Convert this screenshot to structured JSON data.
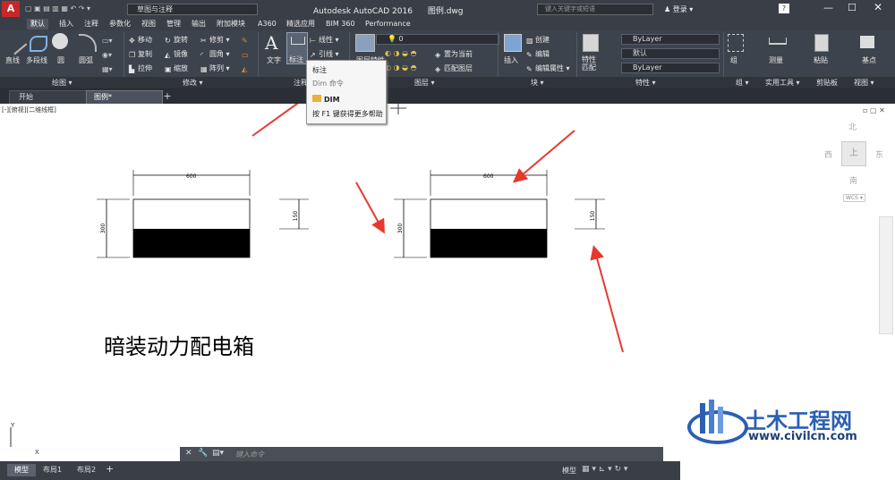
{
  "app": {
    "title": "Autodesk AutoCAD 2016",
    "file": "图例.dwg",
    "workspace": "草图与注释",
    "search_placeholder": "键入关键字或短语",
    "login": "登录"
  },
  "tabs": [
    "默认",
    "插入",
    "注释",
    "参数化",
    "视图",
    "管理",
    "输出",
    "附加模块",
    "A360",
    "精选应用",
    "BIM 360",
    "Performance"
  ],
  "ribbon": {
    "draw": {
      "title": "绘图",
      "items": [
        "直线",
        "多段线",
        "圆",
        "圆弧"
      ]
    },
    "modify": {
      "title": "修改",
      "items": [
        "移动",
        "旋转",
        "修剪",
        "复制",
        "镜像",
        "圆角",
        "拉伸",
        "缩放",
        "阵列"
      ]
    },
    "annotation": {
      "title": "注释",
      "items": [
        "文字",
        "标注",
        "线性",
        "引线"
      ]
    },
    "layers": {
      "title": "图层",
      "items": [
        "图层特性",
        "置为当前",
        "匹配图层"
      ],
      "current_layer": "0"
    },
    "block": {
      "title": "块",
      "items": [
        "插入",
        "创建",
        "编辑",
        "编辑属性"
      ]
    },
    "properties": {
      "title": "特性",
      "items": [
        "特性匹配"
      ],
      "color": "ByLayer",
      "linetype": "默认",
      "lineweight": "ByLayer"
    },
    "groups": {
      "title": "组",
      "items": [
        "组"
      ]
    },
    "utilities": {
      "title": "实用工具",
      "items": [
        "测量"
      ]
    },
    "clipboard": {
      "title": "剪贴板",
      "items": [
        "粘贴"
      ]
    },
    "view": {
      "title": "视图",
      "items": [
        "基点"
      ]
    }
  },
  "tooltip": {
    "title": "标注",
    "command_line": "Dim 命令",
    "command": "DIM",
    "help": "按 F1 键获得更多帮助"
  },
  "filetabs": [
    "开始",
    "图例*"
  ],
  "viewport": {
    "label": "[-][俯视][二维线框]",
    "compass": {
      "north": "北",
      "south": "南",
      "east": "东",
      "west": "西",
      "top": "上",
      "wcs": "WCS"
    }
  },
  "drawing": {
    "dims": {
      "width": "600",
      "height": "300",
      "half": "150"
    },
    "label": "暗装动力配电箱"
  },
  "command": {
    "placeholder": "键入命令"
  },
  "layouts": [
    "模型",
    "布局1",
    "布局2"
  ],
  "status": {
    "model": "模型"
  },
  "watermark": {
    "name": "土木工程网",
    "url": "www.civilcn.com"
  },
  "colors": {
    "arrow": "#e8392f",
    "dark_ui": "#3a3f47",
    "accent": "#2b5fb3"
  }
}
